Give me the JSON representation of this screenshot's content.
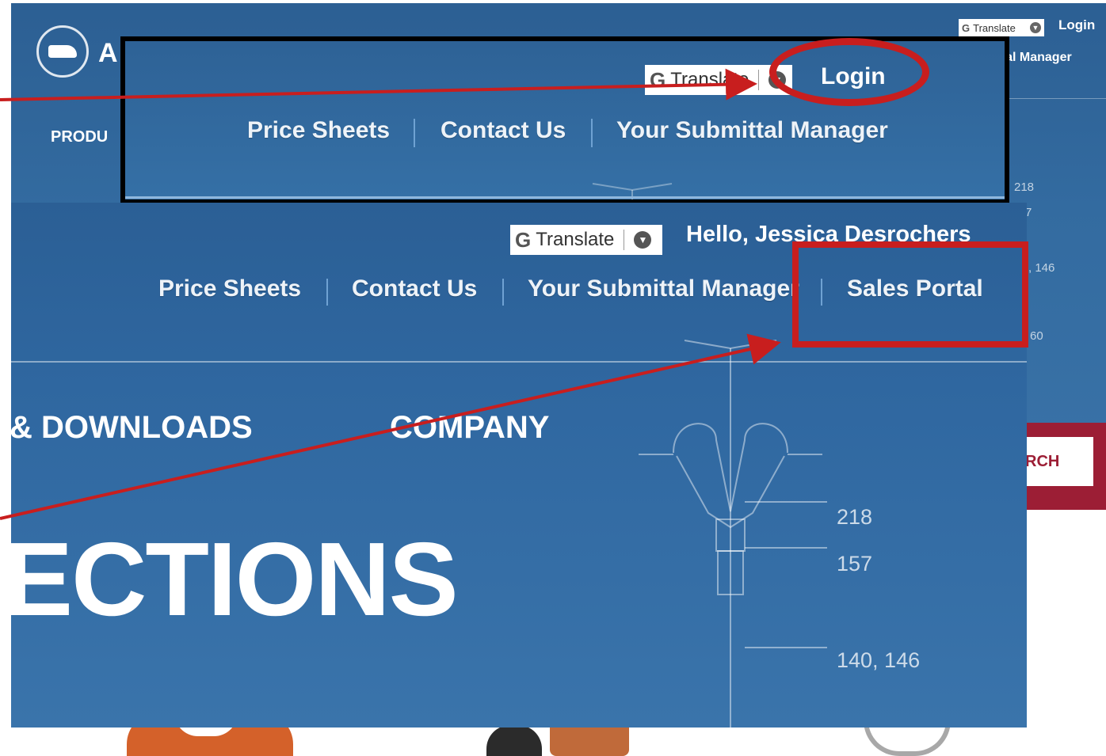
{
  "base": {
    "logo_text": "A",
    "translate": {
      "label": "Translate"
    },
    "login": "Login",
    "submittal": "ittal Manager",
    "products": "PRODU",
    "numbers": [
      "218",
      "7",
      ", 146",
      "60"
    ],
    "search": "RCH"
  },
  "zoom_top": {
    "translate": {
      "label": "Translate"
    },
    "login": "Login",
    "nav": [
      "Price Sheets",
      "Contact Us",
      "Your Submittal Manager"
    ]
  },
  "zoom_bottom": {
    "translate": {
      "label": "Translate"
    },
    "greeting": "Hello, Jessica Desrochers",
    "nav": [
      "Price Sheets",
      "Contact Us",
      "Your Submittal Manager",
      "Sales Portal"
    ],
    "main_nav": [
      "& DOWNLOADS",
      "COMPANY"
    ],
    "headline": "ECTIONS",
    "dimensions": [
      "218",
      "157",
      "140, 146"
    ]
  },
  "colors": {
    "highlight": "#c81e1e",
    "brand_blue": "#2f67a0",
    "search_red": "#9c1e35"
  }
}
